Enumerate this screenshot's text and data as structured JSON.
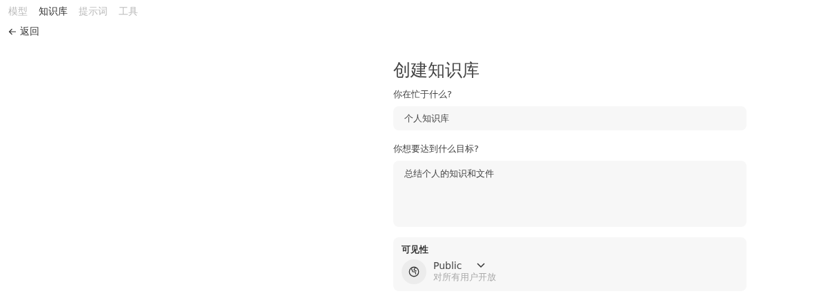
{
  "tabs": [
    {
      "label": "模型",
      "selected": false
    },
    {
      "label": "知识库",
      "selected": true
    },
    {
      "label": "提示词",
      "selected": false
    },
    {
      "label": "工具",
      "selected": false
    }
  ],
  "back_link": {
    "label": "返回"
  },
  "form": {
    "title": "创建知识库",
    "fields": [
      {
        "kind": "input",
        "label": "你在忙于什么?",
        "value": "个人知识库"
      },
      {
        "kind": "textarea",
        "label": "你想要达到什么目标?",
        "value": "总结个人的知识和文件"
      }
    ],
    "visibility": {
      "label": "可见性",
      "value": "Public",
      "description": "对所有用户开放"
    }
  }
}
